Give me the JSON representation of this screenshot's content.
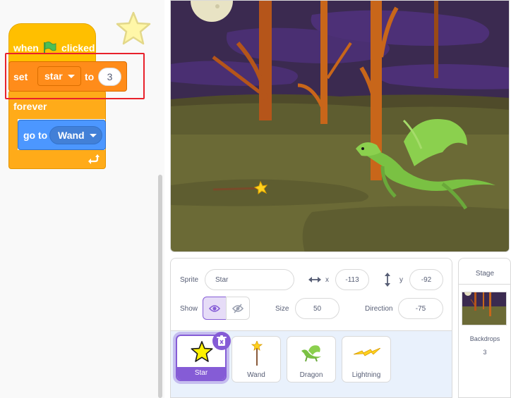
{
  "code": {
    "hat": {
      "when": "when",
      "clicked": "clicked"
    },
    "set": {
      "set": "set",
      "variable": "star",
      "to": "to",
      "value": "3"
    },
    "forever": "forever",
    "goto": {
      "label": "go to",
      "target": "Wand"
    }
  },
  "sprite_info": {
    "sprite_label": "Sprite",
    "sprite_name": "Star",
    "x_label": "x",
    "x_value": "-113",
    "y_label": "y",
    "y_value": "-92",
    "show_label": "Show",
    "size_label": "Size",
    "size_value": "50",
    "direction_label": "Direction",
    "direction_value": "-75"
  },
  "sprites": [
    {
      "name": "Star",
      "selected": true
    },
    {
      "name": "Wand",
      "selected": false
    },
    {
      "name": "Dragon",
      "selected": false
    },
    {
      "name": "Lightning",
      "selected": false
    }
  ],
  "stage_pane": {
    "title": "Stage",
    "backdrops_label": "Backdrops",
    "backdrops_count": "3"
  },
  "colors": {
    "events": "#ffbf00",
    "control": "#ffab19",
    "variables": "#ff8c1a",
    "motion": "#4c97ff",
    "selection": "#855cd6",
    "highlight": "#e8212b"
  }
}
